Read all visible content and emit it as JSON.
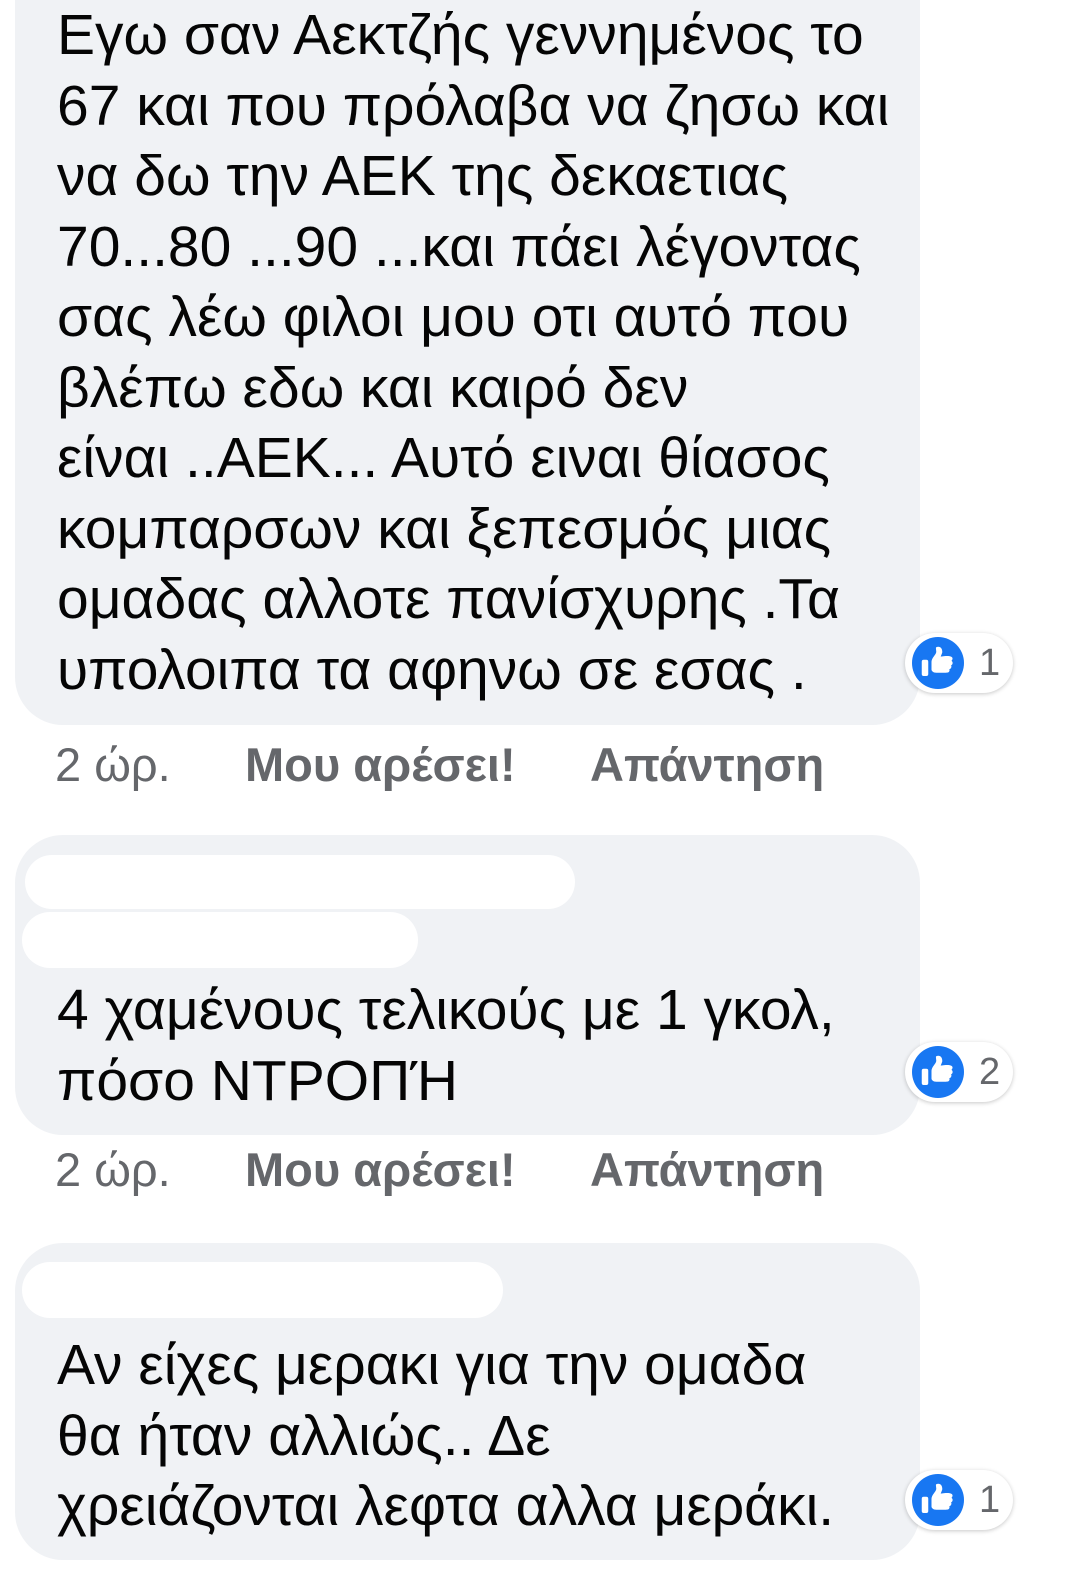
{
  "colors": {
    "page_background": "#ffffff",
    "bubble": "#f0f2f5",
    "text": "#050505",
    "secondary_text": "#65676b",
    "like_blue": "#1877f2"
  },
  "icons": {
    "reaction": "like-icon"
  },
  "comments": [
    {
      "lines": [
        "Εγω σαν Αεκτζής γεννημένος το",
        "67 και που πρόλαβα να ζησω και",
        "να δω την ΑΕΚ της δεκαετιας",
        "70...80 ...90 ...και πάει λέγοντας",
        "σας λέω φιλοι μου οτι αυτό που",
        "βλέπω εδω και καιρό δεν",
        "είναι ..ΑΕΚ... Αυτό ειναι θίασος",
        "κομπαρσων και ξεπεσμός μιας",
        "ομαδας αλλοτε πανίσχυρης .Τα",
        "υπολοιπα τα αφηνω σε εσας ."
      ],
      "reaction_count": "1",
      "time": "2 ώρ.",
      "like_label": "Μου αρέσει!",
      "reply_label": "Απάντηση"
    },
    {
      "lines": [
        "4 χαμένους τελικούς με 1 γκολ,",
        "πόσο ΝΤΡΟΠΉ"
      ],
      "reaction_count": "2",
      "time": "2 ώρ.",
      "like_label": "Μου αρέσει!",
      "reply_label": "Απάντηση"
    },
    {
      "lines": [
        "Αν είχες μερακι για την ομαδα",
        "θα ήταν αλλιώς.. Δε",
        "χρειάζονται λεφτα αλλα μεράκι."
      ],
      "reaction_count": "1"
    }
  ]
}
